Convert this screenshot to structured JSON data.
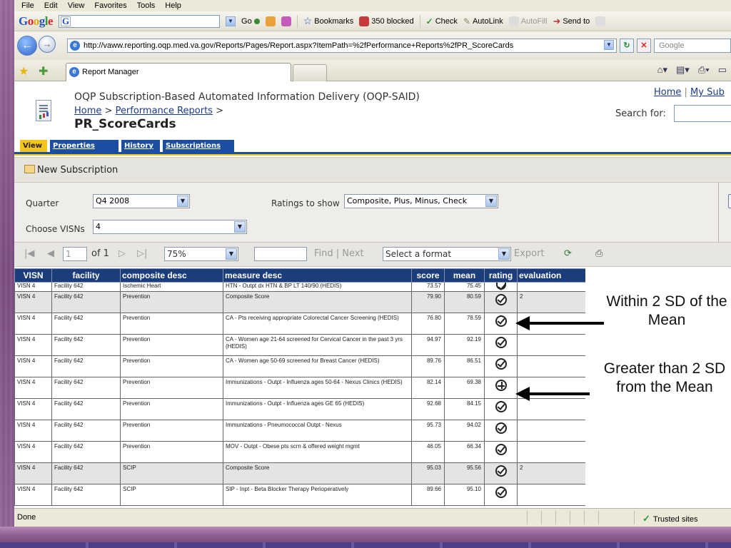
{
  "menu": [
    "File",
    "Edit",
    "View",
    "Favorites",
    "Tools",
    "Help"
  ],
  "google_toolbar": {
    "go_label": "Go",
    "bookmarks_label": "Bookmarks",
    "blocked_label": "350 blocked",
    "check_label": "Check",
    "autolink_label": "AutoLink",
    "autofill_label": "AutoFill",
    "sendto_label": "Send to"
  },
  "address": {
    "url": "http://vaww.reporting.oqp.med.va.gov/Reports/Pages/Report.aspx?ItemPath=%2fPerformance+Reports%2fPR_ScoreCards",
    "search_placeholder": "Google"
  },
  "tab": {
    "title": "Report Manager"
  },
  "header": {
    "app_title": "OQP Subscription-Based Automated Information Delivery (OQP-SAID)",
    "breadcrumb_home": "Home",
    "breadcrumb_sep1": " > ",
    "breadcrumb_perf": "Performance Reports",
    "breadcrumb_sep2": " >",
    "page_title": "PR_ScoreCards",
    "top_link_home": "Home",
    "top_link_sep": " | ",
    "top_link_subs": "My Sub",
    "search_label": "Search for:"
  },
  "report_tabs": [
    "View",
    "Properties",
    "History",
    "Subscriptions"
  ],
  "toolbar": {
    "new_subscription": "New Subscription"
  },
  "params": {
    "quarter_label": "Quarter",
    "quarter_value": "Q4 2008",
    "ratings_label": "Ratings to show",
    "ratings_value": "Composite, Plus, Minus, Check",
    "visns_label": "Choose VISNs",
    "visns_value": "4"
  },
  "viewer": {
    "first": "|◀",
    "prev": "◀",
    "page": "1",
    "of_pages": "of 1",
    "next": "▷",
    "last": "▷|",
    "zoom": "75%",
    "find": "Find",
    "find_sep": " | ",
    "next_label": "Next",
    "format": "Select a format",
    "export": "Export"
  },
  "table": {
    "headers": [
      "VISN",
      "facility",
      "composite desc",
      "measure desc",
      "score",
      "mean",
      "rating",
      "evaluation"
    ],
    "rows": [
      {
        "visn": "VISN 4",
        "facility": "Facility 642",
        "composite": "Ischemic Heart",
        "measure": "HTN - Outpt dx HTN & BP LT 140/90 (HEDIS)",
        "score": "73.57",
        "mean": "75.45",
        "rating": "check",
        "evaluation": "",
        "shaded": false,
        "clipped": true
      },
      {
        "visn": "VISN 4",
        "facility": "Facility 642",
        "composite": "Prevention",
        "measure": "Composite Score",
        "score": "79.90",
        "mean": "80.59",
        "rating": "check",
        "evaluation": "2",
        "shaded": true,
        "clipped": false
      },
      {
        "visn": "VISN 4",
        "facility": "Facility 642",
        "composite": "Prevention",
        "measure": "CA - Pts receiving appropriate Colorectal Cancer Screening (HEDIS)",
        "score": "76.80",
        "mean": "78.59",
        "rating": "check",
        "evaluation": "",
        "shaded": false,
        "clipped": false
      },
      {
        "visn": "VISN 4",
        "facility": "Facility 642",
        "composite": "Prevention",
        "measure": "CA - Women age 21-64 screened for Cervical Cancer in the past 3 yrs (HEDIS)",
        "score": "94.97",
        "mean": "92.19",
        "rating": "check",
        "evaluation": "",
        "shaded": false,
        "clipped": false
      },
      {
        "visn": "VISN 4",
        "facility": "Facility 642",
        "composite": "Prevention",
        "measure": "CA - Women age 50-69 screened for Breast Cancer (HEDIS)",
        "score": "89.76",
        "mean": "86.51",
        "rating": "check",
        "evaluation": "",
        "shaded": false,
        "clipped": false
      },
      {
        "visn": "VISN 4",
        "facility": "Facility 642",
        "composite": "Prevention",
        "measure": "Immunizations - Outpt - Influenza ages 50-64 - Nexus Clinics (HEDIS)",
        "score": "82.14",
        "mean": "69.38",
        "rating": "plus",
        "evaluation": "",
        "shaded": false,
        "clipped": false
      },
      {
        "visn": "VISN 4",
        "facility": "Facility 642",
        "composite": "Prevention",
        "measure": "Immunizations - Outpt - Influenza ages GE 65 (HEDIS)",
        "score": "92.68",
        "mean": "84.15",
        "rating": "check",
        "evaluation": "",
        "shaded": false,
        "clipped": false
      },
      {
        "visn": "VISN 4",
        "facility": "Facility 642",
        "composite": "Prevention",
        "measure": "Immunizations - Pneumococcal Outpt - Nexus",
        "score": "95.73",
        "mean": "94.02",
        "rating": "check",
        "evaluation": "",
        "shaded": false,
        "clipped": false
      },
      {
        "visn": "VISN 4",
        "facility": "Facility 642",
        "composite": "Prevention",
        "measure": "MOV - Outpt - Obese pts scrn & offered weight mgmt",
        "score": "46.05",
        "mean": "66.34",
        "rating": "check",
        "evaluation": "",
        "shaded": false,
        "clipped": false
      },
      {
        "visn": "VISN 4",
        "facility": "Facility 642",
        "composite": "SCIP",
        "measure": "Composite Score",
        "score": "95.03",
        "mean": "95.56",
        "rating": "check",
        "evaluation": "2",
        "shaded": true,
        "clipped": false
      },
      {
        "visn": "VISN 4",
        "facility": "Facility 642",
        "composite": "SCIP",
        "measure": "SIP - Inpt - Beta Blocker Therapy Perioperatively",
        "score": "89.66",
        "mean": "95.10",
        "rating": "check",
        "evaluation": "",
        "shaded": false,
        "clipped": false
      }
    ]
  },
  "annotations": {
    "within": "Within 2 SD of the Mean",
    "greater": "Greater than 2 SD from the Mean"
  },
  "status": {
    "text": "Done",
    "zone": "Trusted sites"
  },
  "colors": {
    "header_blue": "#1b3d7c",
    "tab_yellow": "#f2c41c",
    "tab_blue": "#1b4ea0",
    "slide_purple": "#8a5a8e"
  }
}
